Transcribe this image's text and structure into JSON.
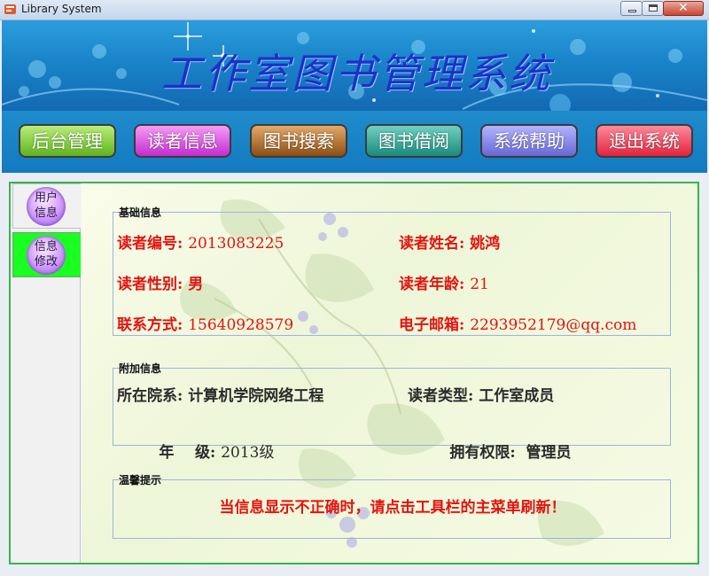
{
  "window": {
    "title": "Library System",
    "close_glyph": "✕"
  },
  "banner": {
    "title": "工作室图书管理系统"
  },
  "nav": {
    "items": [
      {
        "label": "后台管理"
      },
      {
        "label": "读者信息"
      },
      {
        "label": "图书搜索"
      },
      {
        "label": "图书借阅"
      },
      {
        "label": "系统帮助"
      },
      {
        "label": "退出系统"
      }
    ]
  },
  "sidebar": {
    "user_info": {
      "line1": "用户",
      "line2": "信息"
    },
    "info_edit": {
      "line1": "信息",
      "line2": "修改"
    },
    "active_item": "info_edit"
  },
  "basic_info": {
    "legend": "基础信息",
    "reader_id_label": "读者编号: ",
    "reader_id": "2013083225",
    "reader_name_label": "读者姓名: ",
    "reader_name": "姚鸿",
    "gender_label": "读者性别: ",
    "gender": "男",
    "age_label": "读者年龄: ",
    "age": "21",
    "phone_label": "联系方式: ",
    "phone": "15640928579",
    "email_label": "电子邮箱: ",
    "email": "2293952179@qq.com"
  },
  "extra_info": {
    "legend": "附加信息",
    "department_label": "所在院系: ",
    "department": "计算机学院网络工程",
    "reader_type_label": "读者类型: ",
    "reader_type": "工作室成员",
    "grade_label": "年    级: ",
    "grade": "2013级",
    "permission_label": "拥有权限:  ",
    "permission": "管理员"
  },
  "notice": {
    "legend": "温馨提示",
    "text": "当信息显示不正确时，请点击工具栏的主菜单刷新！"
  },
  "colors": {
    "accent_green": "#39b54a",
    "active_tab": "#19ff1f",
    "field_red": "#e3140f",
    "banner_blue": "#1a84c9"
  }
}
